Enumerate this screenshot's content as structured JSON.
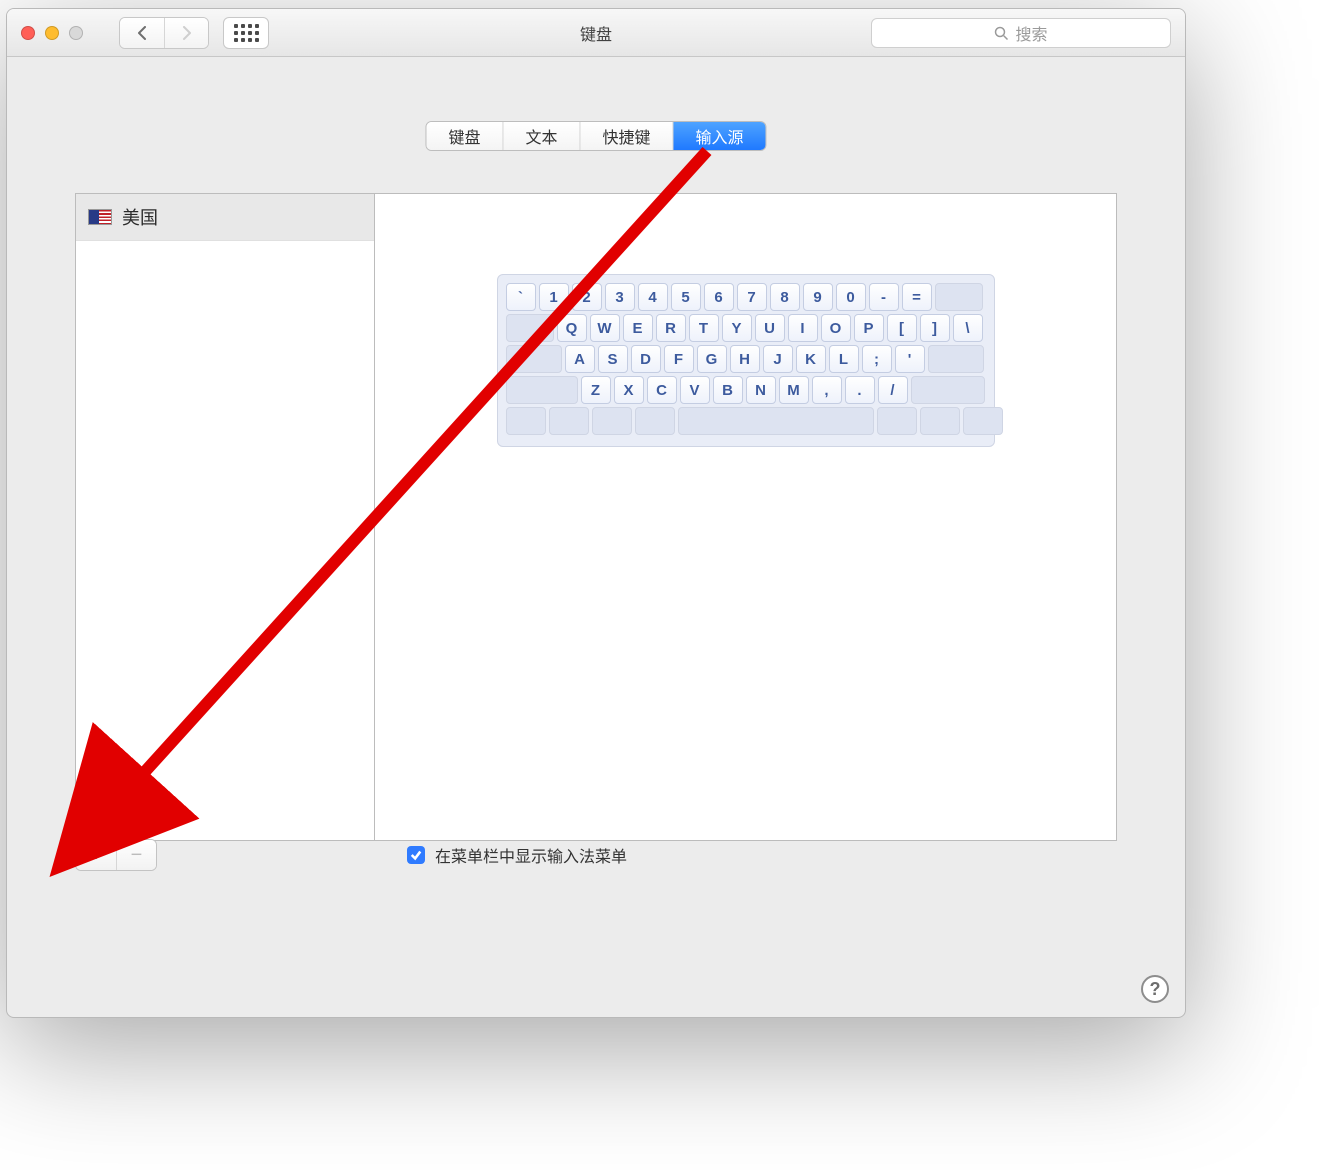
{
  "window": {
    "title": "键盘"
  },
  "search": {
    "placeholder": "搜索"
  },
  "tabs": [
    {
      "label": "键盘",
      "active": false
    },
    {
      "label": "文本",
      "active": false
    },
    {
      "label": "快捷键",
      "active": false
    },
    {
      "label": "输入源",
      "active": true
    }
  ],
  "sidebar": {
    "items": [
      {
        "flag": "us",
        "label": "美国"
      }
    ]
  },
  "keyboard": {
    "rows": [
      [
        "`",
        "1",
        "2",
        "3",
        "4",
        "5",
        "6",
        "7",
        "8",
        "9",
        "0",
        "-",
        "="
      ],
      [
        "Q",
        "W",
        "E",
        "R",
        "T",
        "Y",
        "U",
        "I",
        "O",
        "P",
        "[",
        "]",
        "\\"
      ],
      [
        "A",
        "S",
        "D",
        "F",
        "G",
        "H",
        "J",
        "K",
        "L",
        ";",
        "'"
      ],
      [
        "Z",
        "X",
        "C",
        "V",
        "B",
        "N",
        "M",
        ",",
        ".",
        "/"
      ]
    ]
  },
  "footer": {
    "add_label": "+",
    "remove_label": "−",
    "checkbox_label": "在菜单栏中显示输入法菜单",
    "checkbox_checked": true
  },
  "help": {
    "label": "?"
  },
  "annotation": {
    "from": "tab-输入源",
    "to": "add-button",
    "color": "#e10000"
  }
}
